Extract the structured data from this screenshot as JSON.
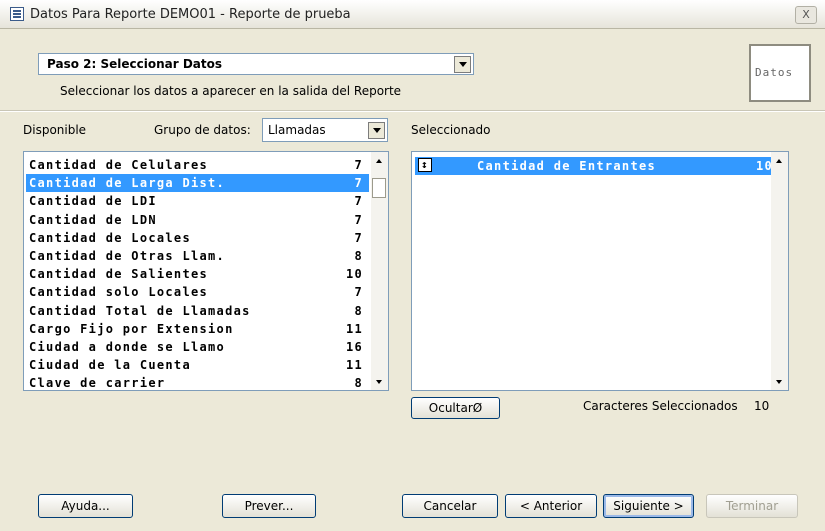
{
  "window": {
    "title": "Datos Para Reporte DEMO01 - Reporte de prueba",
    "close_label": "X"
  },
  "step": {
    "selected": "Paso 2: Seleccionar Datos",
    "description": "Seleccionar los datos a aparecer en la salida del Reporte",
    "badge": "Datos"
  },
  "available": {
    "label": "Disponible",
    "group_label": "Grupo de datos:",
    "group_value": "Llamadas",
    "items": [
      {
        "name": "Cantidad de Celulares",
        "len": "7"
      },
      {
        "name": "Cantidad de Larga Dist.",
        "len": "7",
        "selected": true
      },
      {
        "name": "Cantidad de LDI",
        "len": "7"
      },
      {
        "name": "Cantidad de LDN",
        "len": "7"
      },
      {
        "name": "Cantidad de Locales",
        "len": "7"
      },
      {
        "name": "Cantidad de Otras Llam.",
        "len": "8"
      },
      {
        "name": "Cantidad de Salientes",
        "len": "10"
      },
      {
        "name": "Cantidad solo Locales",
        "len": "7"
      },
      {
        "name": "Cantidad Total de Llamadas",
        "len": "8"
      },
      {
        "name": "Cargo Fijo por Extension",
        "len": "11"
      },
      {
        "name": "Ciudad a donde se Llamo",
        "len": "16"
      },
      {
        "name": "Ciudad de la Cuenta",
        "len": "11"
      },
      {
        "name": "Clave de carrier",
        "len": "8"
      }
    ]
  },
  "selected": {
    "label": "Seleccionado",
    "items": [
      {
        "name": "Cantidad de Entrantes",
        "len": "10"
      }
    ],
    "hide_button": "OcultarØ",
    "chars_label": "Caracteres Seleccionados",
    "chars_count": "10"
  },
  "buttons": {
    "help": "Ayuda...",
    "preview": "Prever...",
    "cancel": "Cancelar",
    "back": "< Anterior",
    "next": "Siguiente >",
    "finish": "Terminar"
  }
}
